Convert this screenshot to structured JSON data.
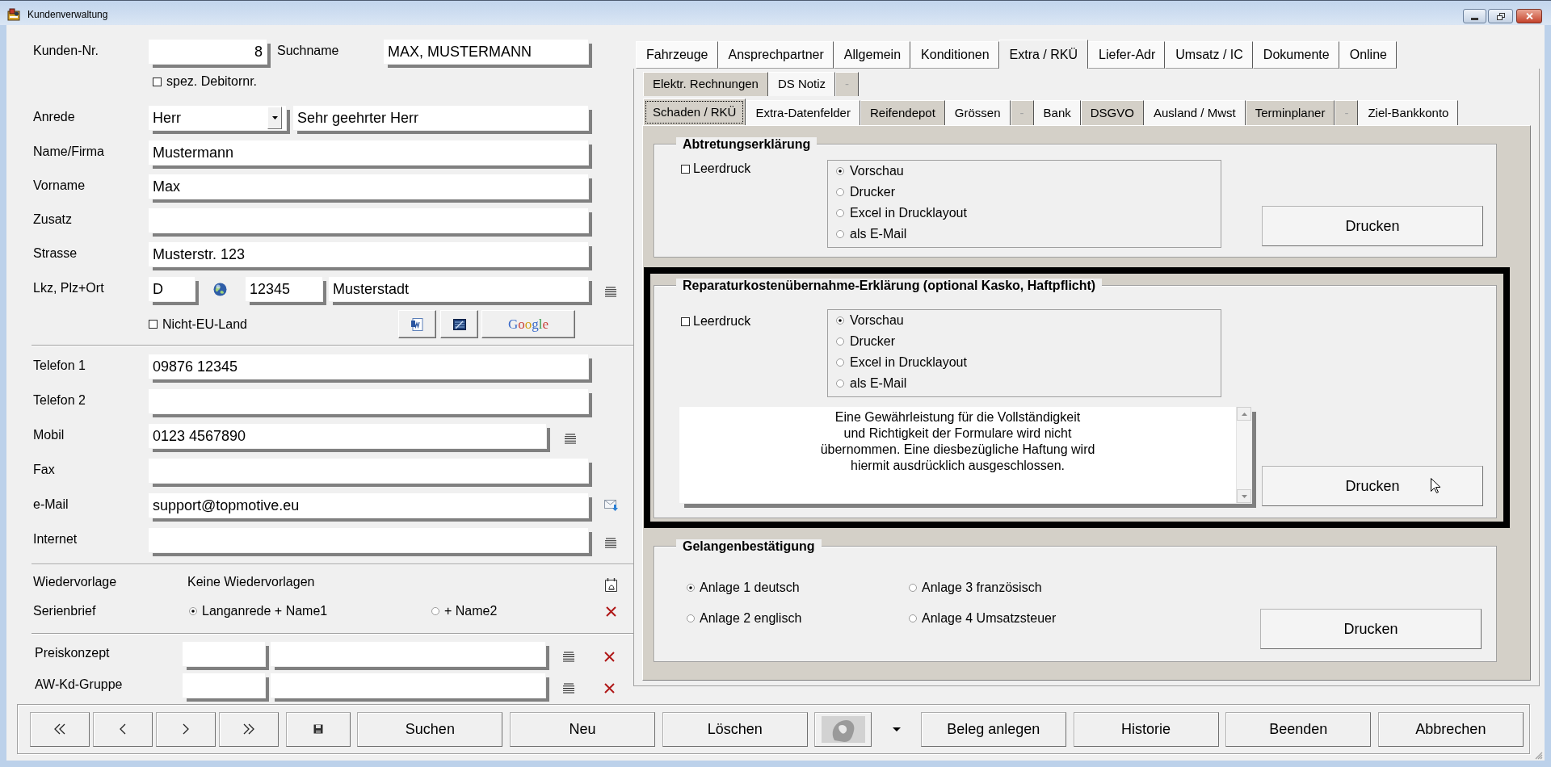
{
  "window": {
    "title": "Kundenverwaltung"
  },
  "customer": {
    "number": {
      "label": "Kunden-Nr.",
      "value": "8"
    },
    "search_name": {
      "label": "Suchname",
      "value": "MAX, MUSTERMANN"
    },
    "special_debtor_no": {
      "label": "spez. Debitornr.",
      "checked": false
    },
    "salutation": {
      "label": "Anrede",
      "value": "Herr",
      "letter_greeting": "Sehr geehrter Herr"
    },
    "address_lines": [
      {
        "label": "Name/Firma",
        "value": "Mustermann"
      },
      {
        "label": "Vorname",
        "value": "Max"
      },
      {
        "label": "Zusatz"
      },
      {
        "label": "Strasse",
        "value": "Musterstr. 123"
      }
    ],
    "location": {
      "label": "Lkz, Plz+Ort",
      "country": "D",
      "postcode": "12345",
      "city": "Musterstadt"
    },
    "non_eu_country": {
      "label": "Nicht-EU-Land",
      "checked": false
    },
    "maps_button": {
      "label": "Google"
    }
  },
  "contact": [
    {
      "kind": "plain",
      "label": "Telefon 1",
      "value": "09876 12345"
    },
    {
      "kind": "plain",
      "label": "Telefon 2"
    },
    {
      "kind": "mobile",
      "label": "Mobil",
      "value": "0123 4567890"
    },
    {
      "kind": "plain",
      "label": "Fax"
    },
    {
      "kind": "email",
      "label": "e-Mail",
      "value": "support@topmotive.eu"
    },
    {
      "kind": "web",
      "label": "Internet"
    }
  ],
  "follow_up": {
    "label": "Wiedervorlage",
    "value": "Keine Wiedervorlagen"
  },
  "serial_letter": {
    "label": "Serienbrief",
    "options": [
      {
        "label": "Langanrede + Name1",
        "selected": true
      },
      {
        "label": "+ Name2",
        "selected": false
      }
    ]
  },
  "pricing": [
    {
      "label": "Preiskonzept"
    },
    {
      "label": "AW-Kd-Gruppe"
    }
  ],
  "tabs": [
    {
      "label": "Fahrzeuge",
      "selected": false
    },
    {
      "label": "Ansprechpartner",
      "selected": false
    },
    {
      "label": "Allgemein",
      "selected": false
    },
    {
      "label": "Konditionen",
      "selected": false
    },
    {
      "label": "Extra / RKÜ",
      "selected": true
    },
    {
      "label": "Liefer-Adr",
      "selected": false
    },
    {
      "label": "Umsatz / IC",
      "selected": false
    },
    {
      "label": "Dokumente",
      "selected": false
    },
    {
      "label": "Online",
      "selected": false
    }
  ],
  "subtabs": [
    [
      {
        "label": "Elektr. Rechnungen",
        "selected": false,
        "shaded": true,
        "disabled": false
      },
      {
        "label": "DS Notiz",
        "selected": false,
        "shaded": false,
        "disabled": false
      },
      {
        "label": "-",
        "selected": false,
        "shaded": true,
        "disabled": true
      }
    ],
    [
      {
        "label": "Schaden / RKÜ",
        "selected": true,
        "shaded": true,
        "disabled": false
      },
      {
        "label": "Extra-Datenfelder",
        "selected": false,
        "shaded": false,
        "disabled": false
      },
      {
        "label": "Reifendepot",
        "selected": false,
        "shaded": true,
        "disabled": false
      },
      {
        "label": "Grössen",
        "selected": false,
        "shaded": false,
        "disabled": false
      },
      {
        "label": "-",
        "selected": false,
        "shaded": true,
        "disabled": true
      },
      {
        "label": "Bank",
        "selected": false,
        "shaded": false,
        "disabled": false
      },
      {
        "label": "DSGVO",
        "selected": false,
        "shaded": true,
        "disabled": false
      },
      {
        "label": "Ausland / Mwst",
        "selected": false,
        "shaded": false,
        "disabled": false
      },
      {
        "label": "Terminplaner",
        "selected": false,
        "shaded": true,
        "disabled": false
      },
      {
        "label": "-",
        "selected": false,
        "shaded": true,
        "disabled": true
      },
      {
        "label": "Ziel-Bankkonto",
        "selected": false,
        "shaded": false,
        "disabled": false
      }
    ]
  ],
  "groups": [
    {
      "kind": "form",
      "title": "Abtretungserklärung",
      "highlighted": false,
      "blank_print": {
        "label": "Leerdruck",
        "checked": false
      },
      "outputs": [
        {
          "label": "Vorschau",
          "selected": true
        },
        {
          "label": "Drucker",
          "selected": false
        },
        {
          "label": "Excel in Drucklayout",
          "selected": false
        },
        {
          "label": "als E-Mail",
          "selected": false
        }
      ],
      "print_button": {
        "label": "Drucken"
      }
    },
    {
      "kind": "form",
      "title": "Reparaturkostenübernahme-Erklärung (optional Kasko, Haftpflicht)",
      "highlighted": true,
      "blank_print": {
        "label": "Leerdruck",
        "checked": false
      },
      "outputs": [
        {
          "label": "Vorschau",
          "selected": true
        },
        {
          "label": "Drucker",
          "selected": false
        },
        {
          "label": "Excel in Drucklayout",
          "selected": false
        },
        {
          "label": "als E-Mail",
          "selected": false
        }
      ],
      "disclaimer": "Eine Gewährleistung für die Vollständigkeit\nund Richtigkeit der Formulare wird nicht\nübernommen. Eine diesbezügliche Haftung wird\nhiermit ausdrücklich ausgeschlossen.",
      "print_button": {
        "label": "Drucken",
        "pointer": true
      }
    },
    {
      "kind": "annex",
      "title": "Gelangenbestätigung",
      "highlighted": false,
      "options": [
        {
          "label": "Anlage 1 deutsch",
          "selected": true
        },
        {
          "label": "Anlage 3 französisch",
          "selected": false
        },
        {
          "label": "Anlage 2 englisch",
          "selected": false
        },
        {
          "label": "Anlage 4 Umsatzsteuer",
          "selected": false
        }
      ],
      "print_button": {
        "label": "Drucken"
      }
    }
  ],
  "toolbar": [
    {
      "kind": "first"
    },
    {
      "kind": "previous"
    },
    {
      "kind": "next"
    },
    {
      "kind": "last"
    },
    {
      "kind": "save"
    },
    {
      "kind": "text",
      "label": "Suchen"
    },
    {
      "kind": "text",
      "label": "Neu"
    },
    {
      "kind": "text",
      "label": "Löschen"
    },
    {
      "kind": "image"
    },
    {
      "kind": "menu"
    },
    {
      "kind": "text",
      "label": "Beleg anlegen"
    },
    {
      "kind": "text",
      "label": "Historie"
    },
    {
      "kind": "text",
      "label": "Beenden"
    },
    {
      "kind": "text",
      "label": "Abbrechen"
    }
  ]
}
